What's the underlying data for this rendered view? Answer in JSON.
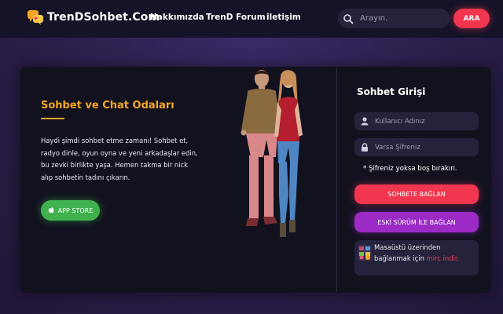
{
  "brand": {
    "name": "TrenDSohbet.Com"
  },
  "nav": {
    "links": [
      {
        "label": "Hakkımızda"
      },
      {
        "label": "TrenD Forum"
      },
      {
        "label": "iletişim"
      }
    ]
  },
  "search": {
    "placeholder": "Arayın.",
    "button": "ARA"
  },
  "hero": {
    "title": "Sohbet ve Chat Odaları",
    "lines": [
      "Haydi şimdi sohbet etme zamanı! Sohbet et,",
      "radyo dinle, oyun oyna ve yeni arkadaşlar edin,",
      "bu zevki birlikte yaşa. Hemen takma bir nick",
      "alıp sohbetin tadını çıkarın."
    ],
    "app_store": "APP STORE"
  },
  "login": {
    "title": "Sohbet Girişi",
    "username_placeholder": "Kullanıcı Adınız",
    "password_placeholder": "Varsa Şifreniz",
    "hint": "* Şifreniz yoksa boş bırakın.",
    "connect_button": "SOHBETE BAĞLAN",
    "old_version_button": "ESKİ SÜRÜM İLE BAĞLAN",
    "mirc_line1": "Masaüstü üzerinden",
    "mirc_line2_prefix": "bağlanmak için",
    "mirc_link": "mirc indir."
  },
  "colors": {
    "accent_orange": "#f5a623",
    "accent_red": "#f2364f",
    "accent_purple": "#9b2bc4",
    "accent_green": "#3fb24e",
    "navbar": "#141327",
    "card": "#12121f"
  },
  "icons": {
    "logo": "chat-bubbles-icon",
    "search": "search-icon",
    "apple": "apple-icon",
    "user": "user-icon",
    "lock": "lock-icon",
    "mirc": "mirc-icon"
  }
}
